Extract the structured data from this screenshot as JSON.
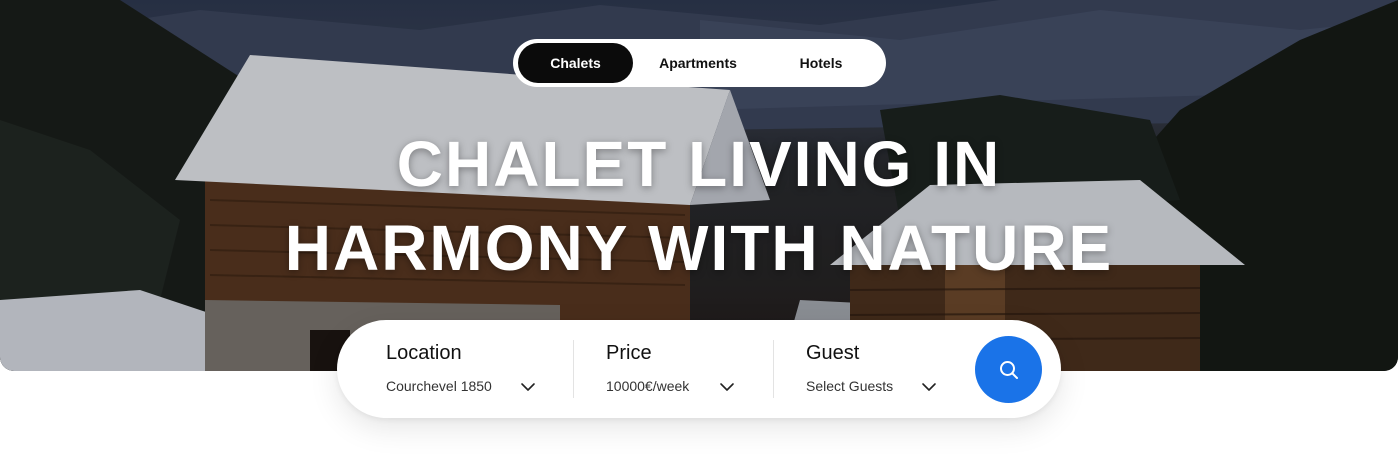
{
  "tabs": [
    {
      "label": "Chalets",
      "active": true
    },
    {
      "label": "Apartments",
      "active": false
    },
    {
      "label": "Hotels",
      "active": false
    }
  ],
  "hero": {
    "headline_line1": "CHALET LIVING IN",
    "headline_line2": "HARMONY WITH NATURE"
  },
  "search": {
    "location": {
      "label": "Location",
      "value": "Courchevel 1850",
      "icon": "chevron-down-icon"
    },
    "price": {
      "label": "Price",
      "value": "10000€/week",
      "icon": "chevron-down-icon"
    },
    "guest": {
      "label": "Guest",
      "value": "Select Guests",
      "icon": "chevron-down-icon"
    },
    "button_icon": "search-icon"
  },
  "colors": {
    "accent": "#1a73e8",
    "active_tab": "#0b0b0b",
    "tab_bar": "#ffffff"
  }
}
